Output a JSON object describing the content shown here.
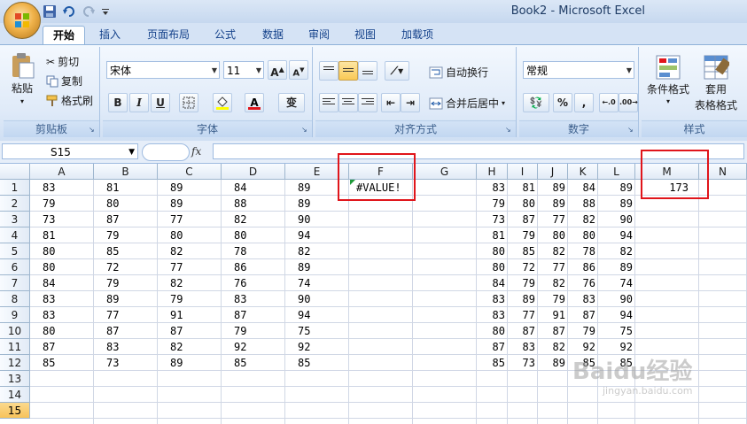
{
  "window": {
    "title": "Book2 - Microsoft Excel"
  },
  "quick_access": [
    {
      "icon": "save-icon"
    },
    {
      "icon": "undo-icon"
    },
    {
      "icon": "redo-icon"
    },
    {
      "icon": "customize-qat-icon"
    }
  ],
  "tabs": [
    {
      "label": "开始",
      "active": true
    },
    {
      "label": "插入"
    },
    {
      "label": "页面布局"
    },
    {
      "label": "公式"
    },
    {
      "label": "数据"
    },
    {
      "label": "审阅"
    },
    {
      "label": "视图"
    },
    {
      "label": "加载项"
    }
  ],
  "ribbon": {
    "clipboard": {
      "label": "剪贴板",
      "paste": "粘贴",
      "cut": "剪切",
      "copy": "复制",
      "format_painter": "格式刷"
    },
    "font": {
      "label": "字体",
      "font_name": "宋体",
      "font_size": "11",
      "bold": "B",
      "italic": "I",
      "underline": "U",
      "phonetic": "变"
    },
    "alignment": {
      "label": "对齐方式",
      "wrap_text": "自动换行",
      "merge_center": "合并后居中"
    },
    "number": {
      "label": "数字",
      "format": "常规",
      "percent": "%",
      "comma": ","
    },
    "styles": {
      "label": "样式",
      "conditional": "条件格式",
      "table_format_1": "套用",
      "table_format_2": "表格格式"
    }
  },
  "formula_bar": {
    "name_box": "S15",
    "fx": "fx",
    "formula": ""
  },
  "sheet": {
    "columns": [
      "A",
      "B",
      "C",
      "D",
      "E",
      "F",
      "G",
      "H",
      "I",
      "J",
      "K",
      "L",
      "M",
      "N"
    ],
    "rows": [
      "1",
      "2",
      "3",
      "4",
      "5",
      "6",
      "7",
      "8",
      "9",
      "10",
      "11",
      "12",
      "13",
      "14",
      "15"
    ],
    "selected_row": "15",
    "left_block": [
      [
        "83",
        "81",
        "89",
        "84",
        "89"
      ],
      [
        "79",
        "80",
        "89",
        "88",
        "89"
      ],
      [
        "73",
        "87",
        "77",
        "82",
        "90"
      ],
      [
        "81",
        "79",
        "80",
        "80",
        "94"
      ],
      [
        "80",
        "85",
        "82",
        "78",
        "82"
      ],
      [
        "80",
        "72",
        "77",
        "86",
        "89"
      ],
      [
        "84",
        "79",
        "82",
        "76",
        "74"
      ],
      [
        "83",
        "89",
        "79",
        "83",
        "90"
      ],
      [
        "83",
        "77",
        "91",
        "87",
        "94"
      ],
      [
        "80",
        "87",
        "87",
        "79",
        "75"
      ],
      [
        "87",
        "83",
        "82",
        "92",
        "92"
      ],
      [
        "85",
        "73",
        "89",
        "85",
        "85"
      ]
    ],
    "right_block": [
      [
        "83",
        "81",
        "89",
        "84",
        "89"
      ],
      [
        "79",
        "80",
        "89",
        "88",
        "89"
      ],
      [
        "73",
        "87",
        "77",
        "82",
        "90"
      ],
      [
        "81",
        "79",
        "80",
        "80",
        "94"
      ],
      [
        "80",
        "85",
        "82",
        "78",
        "82"
      ],
      [
        "80",
        "72",
        "77",
        "86",
        "89"
      ],
      [
        "84",
        "79",
        "82",
        "76",
        "74"
      ],
      [
        "83",
        "89",
        "79",
        "83",
        "90"
      ],
      [
        "83",
        "77",
        "91",
        "87",
        "94"
      ],
      [
        "80",
        "87",
        "87",
        "79",
        "75"
      ],
      [
        "87",
        "83",
        "82",
        "92",
        "92"
      ],
      [
        "85",
        "73",
        "89",
        "85",
        "85"
      ]
    ],
    "f1_value": "#VALUE!",
    "m1_value": "173"
  },
  "watermark": {
    "brand": "Baidu经验",
    "url": "jingyan.baidu.com"
  },
  "colors": {
    "highlight_red": "#e0151b",
    "selected_row": "#f7c35a",
    "ribbon_blue": "#dfeaf8"
  }
}
